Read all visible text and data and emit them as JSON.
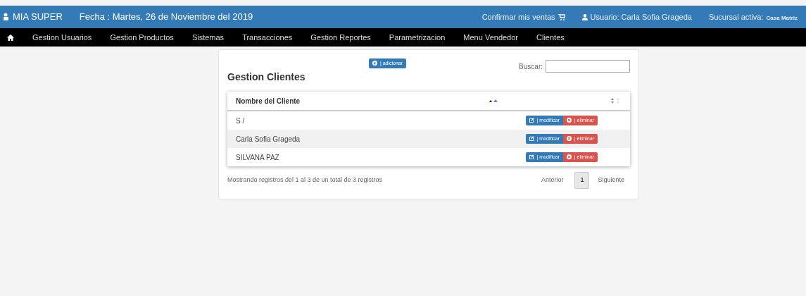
{
  "topbar": {
    "brand": "MIA SUPER",
    "date": "Fecha : Martes, 26 de Noviembre del 2019",
    "confirm": "Confirmar mis ventas",
    "user": "Usuario: Carla Sofia Grageda",
    "branch_label": "Sucursal activa:",
    "branch": "Casa Matriz"
  },
  "menu": [
    {
      "label": "Gestion Usuarios"
    },
    {
      "label": "Gestion Productos"
    },
    {
      "label": "Sistemas"
    },
    {
      "label": "Transacciones"
    },
    {
      "label": "Gestion Reportes"
    },
    {
      "label": "Parametrizacion"
    },
    {
      "label": "Menu Vendedor"
    },
    {
      "label": "Clientes"
    }
  ],
  "panel": {
    "title": "Gestion Clientes",
    "add_button": "| adicionar",
    "search_label": "Buscar:",
    "table": {
      "columns": [
        "Nombre del Cliente"
      ],
      "rows": [
        {
          "name": "S /",
          "edit": "| modificar",
          "delete": "| eliminar"
        },
        {
          "name": "Carla Sofia Grageda",
          "edit": "| modificar",
          "delete": "| eliminar"
        },
        {
          "name": "SILVANA PAZ",
          "edit": "| modificar",
          "delete": "| eliminar"
        }
      ]
    },
    "info": "Mostrando registros del 1 al 3 de un total de 3 registros",
    "pagination": {
      "previous": "Anterior",
      "pages": [
        {
          "label": "1",
          "selected": true
        }
      ],
      "next": "Siguiente"
    }
  }
}
